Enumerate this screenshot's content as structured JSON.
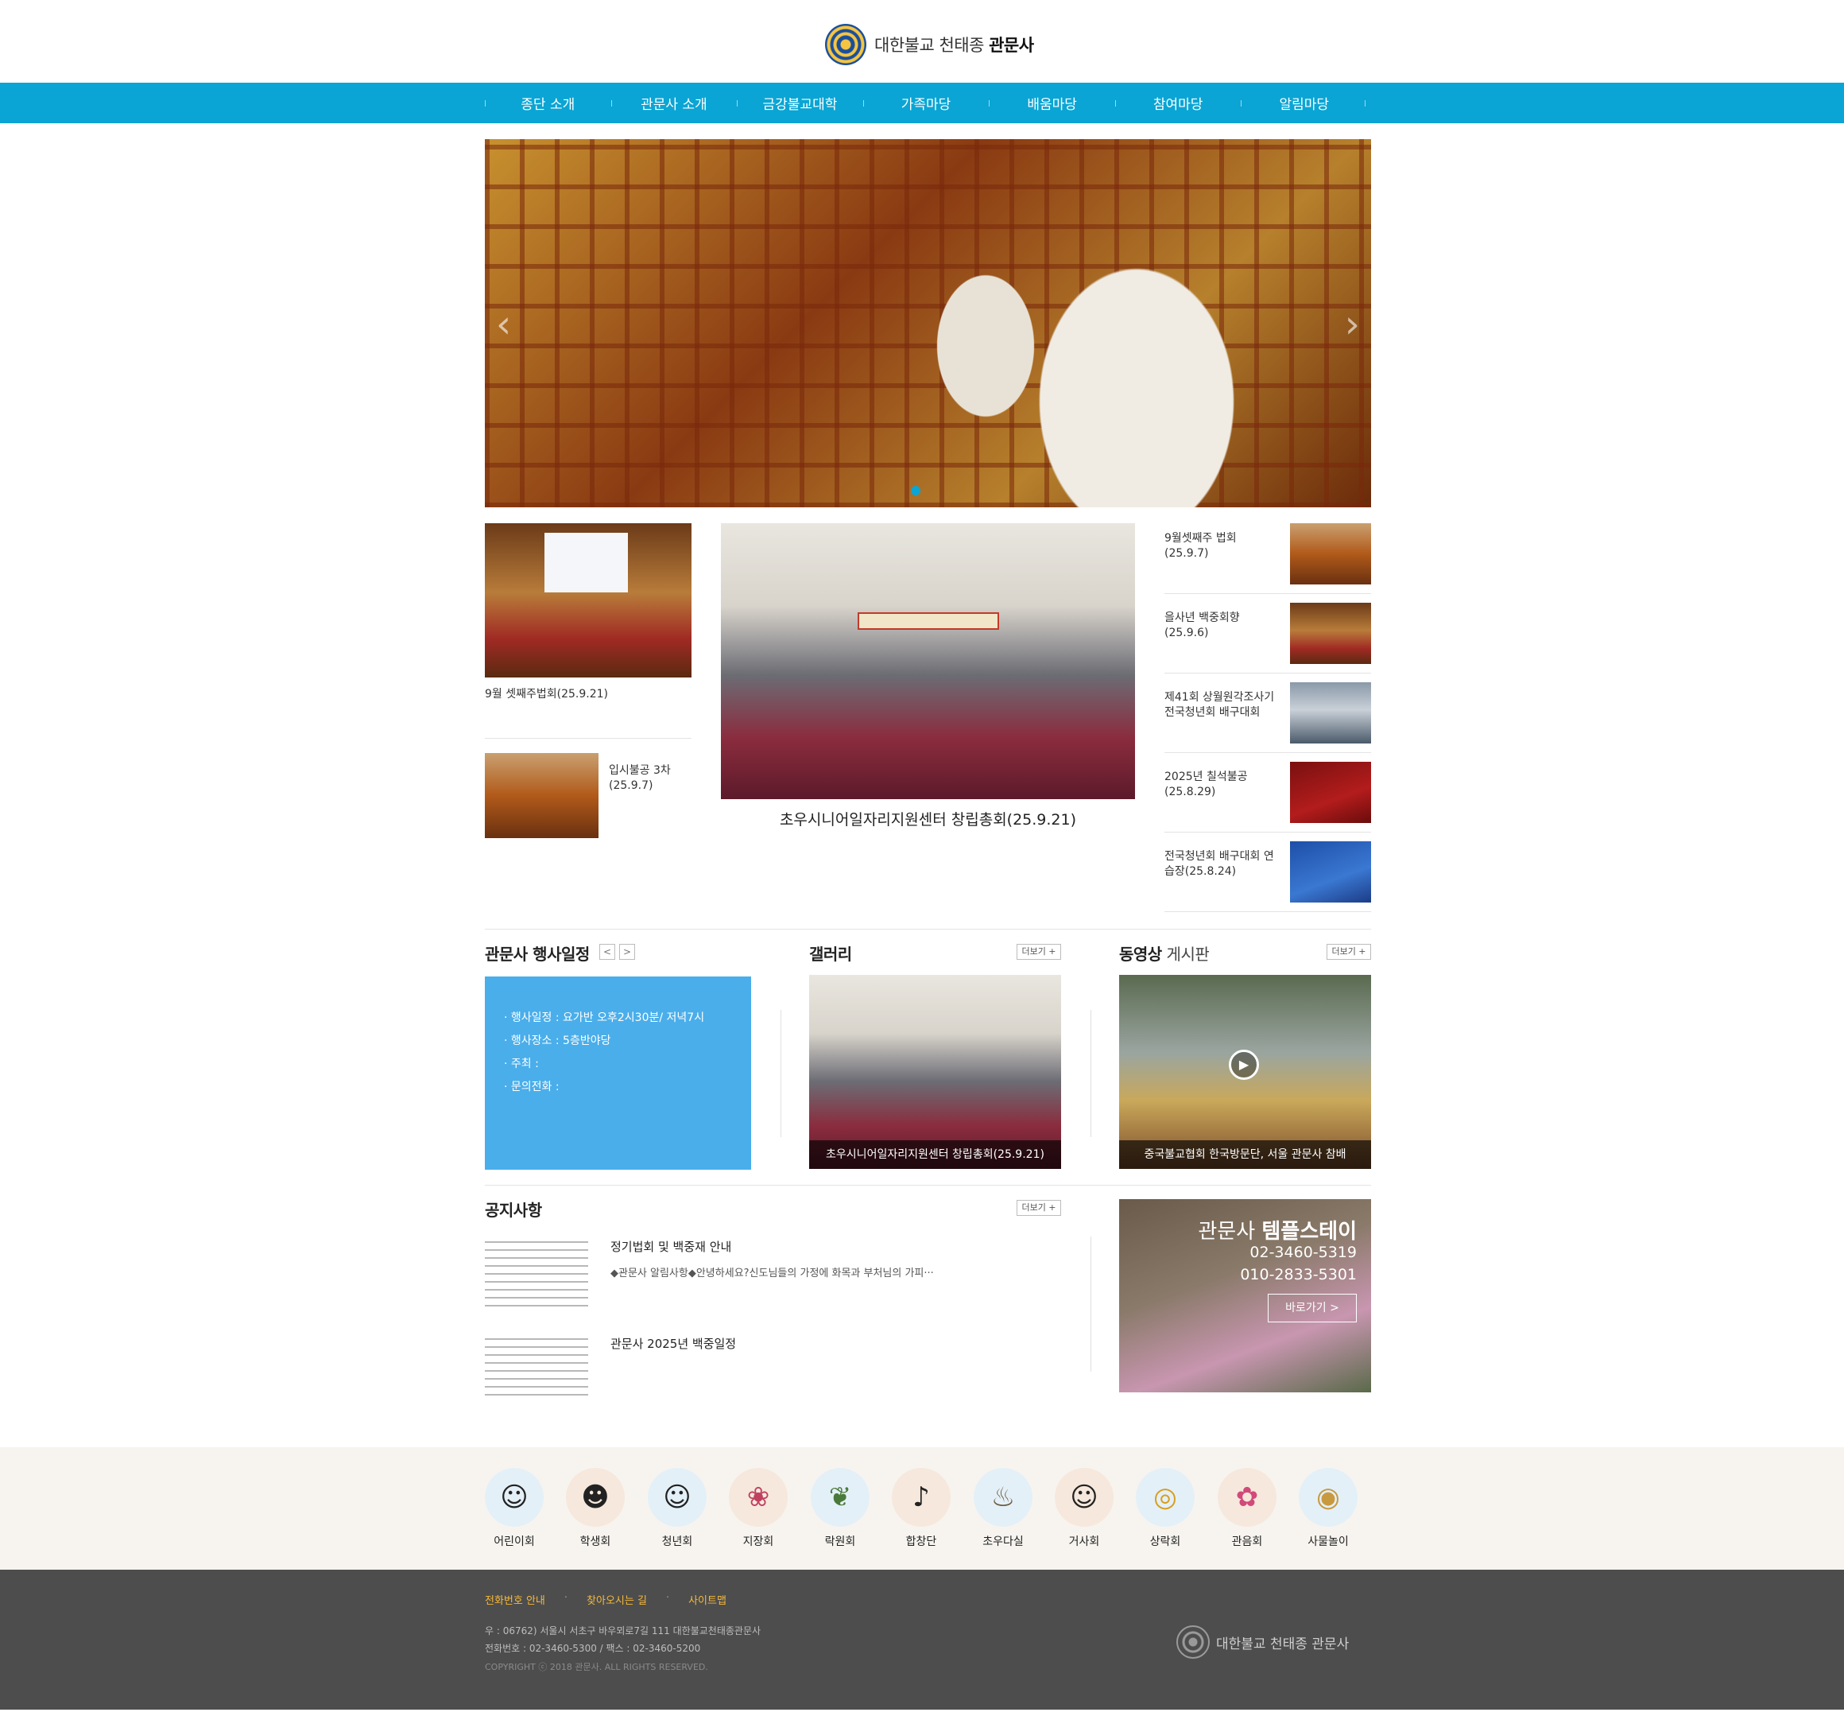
{
  "header": {
    "brand_prefix": "대한불교 천태종",
    "brand_name": "관문사"
  },
  "nav": {
    "items": [
      {
        "label": "종단 소개"
      },
      {
        "label": "관문사 소개"
      },
      {
        "label": "금강불교대학"
      },
      {
        "label": "가족마당"
      },
      {
        "label": "배움마당"
      },
      {
        "label": "참여마당"
      },
      {
        "label": "알림마당"
      }
    ]
  },
  "hero": {
    "prev_icon": "chevron-left-icon",
    "next_icon": "chevron-right-icon"
  },
  "news": {
    "left_top_caption": "9월 셋째주법회(25.9.21)",
    "left_bottom_caption": "입시불공 3차\n(25.9.7)",
    "center_caption": "초우시니어일자리지원센터 창립총회(25.9.21)",
    "right_items": [
      {
        "caption": "9월셋째주 법회\n(25.9.7)"
      },
      {
        "caption": "을사년 백중회향\n(25.9.6)"
      },
      {
        "caption": "제41회 상월원각조사기\n전국청년회 배구대회"
      },
      {
        "caption": "2025년 칠석불공\n(25.8.29)"
      },
      {
        "caption": "전국청년회 배구대회 연\n습장(25.8.24)"
      }
    ]
  },
  "schedule": {
    "title": "관문사 행사일정",
    "prev": "<",
    "next": ">",
    "lines": [
      "· 행사일정 : 요가반 오후2시30분/ 저녁7시",
      "· 행사장소 : 5층반야당",
      "· 주최 :",
      "· 문의전화 :"
    ]
  },
  "gallery": {
    "title": "갤러리",
    "more": "더보기 +",
    "caption": "초우시니어일자리지원센터 창립총회(25.9.21)"
  },
  "video": {
    "title_bold": "동영상",
    "title_thin": " 게시판",
    "more": "더보기 +",
    "caption": "중국불교협회 한국방문단, 서울 관문사 참배"
  },
  "notice": {
    "title": "공지사항",
    "more": "더보기 +",
    "items": [
      {
        "title": "정기법회 및 백중재 안내",
        "summary": "◆관문사 알림사항◆안녕하세요?신도님들의 가정에 화목과 부처님의 가피···"
      },
      {
        "title": "관문사 2025년 백중일정",
        "summary": ""
      }
    ]
  },
  "templestay": {
    "title_prefix": "관문사",
    "title_bold": "템플스테이",
    "phone1": "02-3460-5319",
    "phone2": "010-2833-5301",
    "button": "바로가기 >"
  },
  "clubs": [
    {
      "label": "어린이회",
      "icon": "child-icon",
      "color": "#e4f0f8"
    },
    {
      "label": "학생회",
      "icon": "student-icon",
      "color": "#f6e8dc"
    },
    {
      "label": "청년회",
      "icon": "youth-icon",
      "color": "#e4f0f8"
    },
    {
      "label": "지장회",
      "icon": "plum-blossom-icon",
      "color": "#f6e8dc"
    },
    {
      "label": "락원회",
      "icon": "bamboo-icon",
      "color": "#e4f0f8"
    },
    {
      "label": "합창단",
      "icon": "choir-icon",
      "color": "#f6e8dc"
    },
    {
      "label": "초우다실",
      "icon": "tea-kettle-icon",
      "color": "#e4f0f8"
    },
    {
      "label": "거사회",
      "icon": "elder-icon",
      "color": "#f6e8dc"
    },
    {
      "label": "상락회",
      "icon": "lantern-icon",
      "color": "#e4f0f8"
    },
    {
      "label": "관음회",
      "icon": "lotus-icon",
      "color": "#f6e8dc"
    },
    {
      "label": "사물놀이",
      "icon": "drum-icon",
      "color": "#e4f0f8"
    }
  ],
  "footer": {
    "links": [
      "전화번호 안내",
      "찾아오시는 길",
      "사이트맵"
    ],
    "address": "우 : 06762) 서울시 서초구 바우뫼로7길 111 대한불교천태종관문사",
    "phone": "전화번호 : 02-3460-5300 / 팩스 : 02-3460-5200",
    "copyright": "COPYRIGHT ⓒ 2018 관문사. ALL RIGHTS RESERVED.",
    "brand": "대한불교 천태종 관문사"
  }
}
